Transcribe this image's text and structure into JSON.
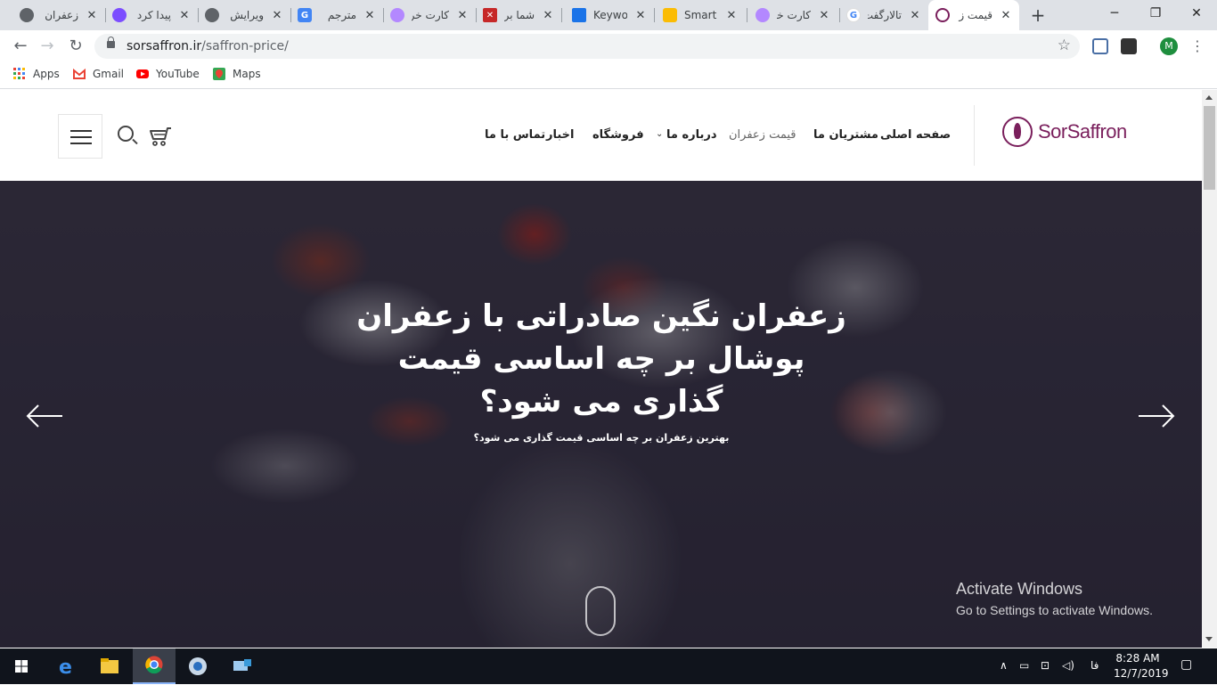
{
  "browser": {
    "tabs": [
      {
        "title": "زعفران",
        "favicon_color": "#5f6368"
      },
      {
        "title": "پیدا کرد",
        "favicon_color": "#7c4dff"
      },
      {
        "title": "ویرایش",
        "favicon_color": "#5f6368"
      },
      {
        "title": "مترجم",
        "favicon_color": "#4285f4"
      },
      {
        "title": "کارت خر",
        "favicon_color": "#b388ff"
      },
      {
        "title": "شما برا",
        "favicon_color": "#c62828"
      },
      {
        "title": "Keywor",
        "favicon_color": "#1a73e8"
      },
      {
        "title": "Smart",
        "favicon_color": "#fbbc04"
      },
      {
        "title": "کارت خر",
        "favicon_color": "#b388ff"
      },
      {
        "title": "تالارگفت",
        "favicon_color": "#4285f4"
      },
      {
        "title": "قیمت ز",
        "favicon_color": "#7a1f5c"
      }
    ],
    "url_host": "sorsaffron.ir",
    "url_path": "/saffron-price/",
    "profile_initial": "M",
    "bookmarks": [
      {
        "label": "Apps",
        "icon": "apps-grid-icon"
      },
      {
        "label": "Gmail",
        "icon": "gmail-icon"
      },
      {
        "label": "YouTube",
        "icon": "youtube-icon"
      },
      {
        "label": "Maps",
        "icon": "maps-icon"
      }
    ]
  },
  "site": {
    "logo_text": "SorSaffron",
    "nav": {
      "home": "صفحه اصلی",
      "customers": "مشتریان ما",
      "price": "قیمت زعفران",
      "about": "درباره ما",
      "shop": "فروشگاه",
      "news": "اخبار",
      "contact": "تماس با ما"
    },
    "hero": {
      "title": "زعفران نگین صادراتی با زعفران پوشال بر چه اساسی قیمت گذاری می شود؟",
      "subtitle": "بهترین زعفران بر چه اساسی قیمت گذاری می شود؟"
    }
  },
  "watermark": {
    "line1": "Activate Windows",
    "line2": "Go to Settings to activate Windows."
  },
  "taskbar": {
    "lang": "فا",
    "time": "8:28 AM",
    "date": "12/7/2019"
  },
  "colors": {
    "brand": "#7a1f5c",
    "taskbar": "#10141c"
  }
}
